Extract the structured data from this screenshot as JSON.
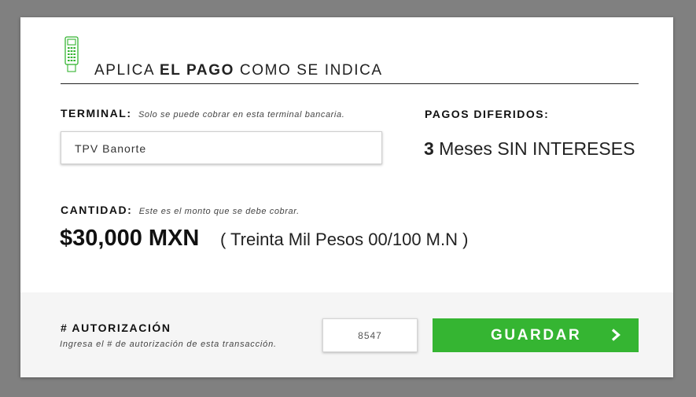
{
  "header": {
    "title_part1": "APLICA ",
    "title_bold": "EL PAGO",
    "title_part2": " COMO SE INDICA",
    "icon": "pos-terminal-icon",
    "icon_color": "#35b532"
  },
  "terminal": {
    "label": "TERMINAL:",
    "help": "Solo se puede cobrar en esta terminal bancaria.",
    "value": "TPV Banorte"
  },
  "diferidos": {
    "label": "PAGOS DIFERIDOS:",
    "number": "3",
    "text": " Meses SIN INTERESES"
  },
  "cantidad": {
    "label": "CANTIDAD:",
    "help": "Este es el monto que se debe cobrar.",
    "amount": "$30,000 MXN",
    "amount_words": "( Treinta Mil Pesos 00/100 M.N )"
  },
  "autorizacion": {
    "label": "# AUTORIZACIÓN",
    "help": "Ingresa el # de autorización de esta transacción.",
    "value": "8547"
  },
  "save_button": {
    "label": "GUARDAR",
    "icon": "chevron-right-icon",
    "color": "#35b532"
  }
}
